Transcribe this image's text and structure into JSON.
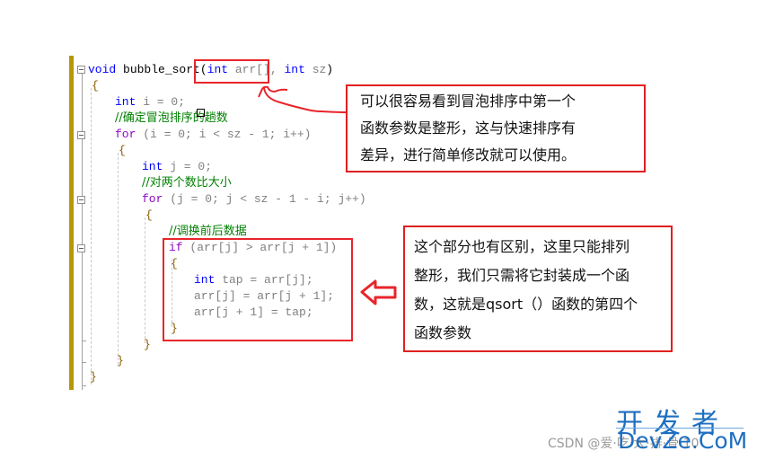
{
  "code": {
    "lines": [
      {
        "kind": "sig",
        "void": "void",
        "name": " bubble_sort",
        "open": "(",
        "p1t": "int",
        "p1": " arr[],",
        "sp": " ",
        "p2t": "int",
        "p2": " sz",
        "close": ")"
      },
      {
        "text": "{"
      },
      {
        "kw": "int",
        "rest": " i = 0;"
      },
      {
        "comment": "//确定冒泡排序的趟数"
      },
      {
        "kw2": "for",
        "rest": " (i = 0; i < sz - 1; i++)"
      },
      {
        "text": "{"
      },
      {
        "kw": "int",
        "rest": " j = 0;"
      },
      {
        "comment": "//对两个数比大小"
      },
      {
        "kw2": "for",
        "rest": " (j = 0; j < sz - 1 - i; j++)"
      },
      {
        "text": "{"
      },
      {
        "comment": "//调换前后数据"
      },
      {
        "kw2": "if",
        "rest": " (arr[j] > arr[j + 1])"
      },
      {
        "text": "{"
      },
      {
        "kw": "int",
        "rest": " tap = arr[j];"
      },
      {
        "text": "arr[j] = arr[j + 1];"
      },
      {
        "text": "arr[j + 1] = tap;"
      },
      {
        "text": "}"
      },
      {
        "text": "}"
      },
      {
        "text": "}"
      },
      {
        "text": "}"
      }
    ]
  },
  "notes": {
    "top": [
      "可以很容易看到冒泡排序中第一个",
      "函数参数是整形，这与快速排序有",
      "差异，进行简单修改就可以使用。"
    ],
    "bottom": [
      "这个部分也有区别，这里只能排列",
      "整形，我们只需将它封装成一个函",
      "数，这就是qsort（）函数的第四个",
      "函数参数"
    ]
  },
  "watermark": {
    "cn": "开发者",
    "en": "DevZe.CoM",
    "csdn": "CSDN @爱·吃·大·排·骨·10"
  },
  "colors": {
    "annotation_red": "#e8252a",
    "keyword_blue": "#0000ff",
    "comment_green": "#008000"
  }
}
